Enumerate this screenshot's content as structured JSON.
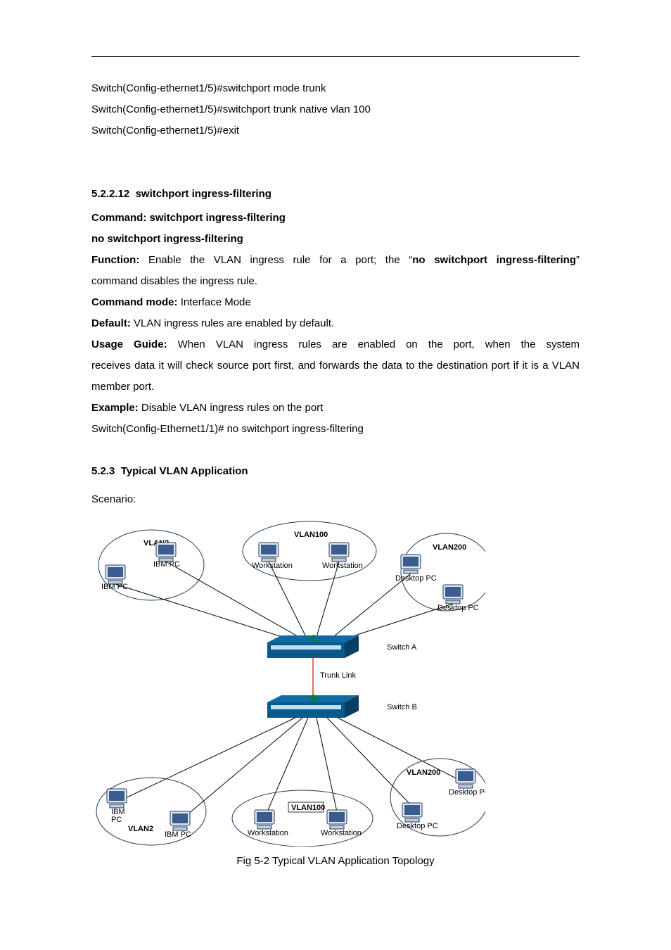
{
  "code": {
    "l1": "Switch(Config-ethernet1/5)#switchport mode trunk",
    "l2": "Switch(Config-ethernet1/5)#switchport trunk native vlan 100",
    "l3": "Switch(Config-ethernet1/5)#exit"
  },
  "cmd": {
    "heading_num": "5.2.2.12",
    "heading_txt": "switchport ingress-filtering",
    "command_lbl": "Command:",
    "command_txt": "switchport ingress-filtering",
    "no_form": "no switchport ingress-filtering",
    "function_lbl": "Function:",
    "function_txt_a": "Enable the VLAN ingress rule for a port; the “",
    "function_txt_b": "no switchport ingress-filtering",
    "function_txt_c": "”",
    "function_txt2": "command disables the ingress rule.",
    "mode_lbl": "Command mode:",
    "mode_txt": "Interface Mode",
    "default_lbl": "Default:",
    "default_txt": "VLAN ingress rules are enabled by default.",
    "usage_lbl": "Usage Guide:",
    "usage_txt1": "When VLAN ingress rules are enabled on the port, when the system",
    "usage_txt2": "receives data it will check source port first, and forwards the data to the destination port if it is a VLAN member port.",
    "example_lbl": "Example:",
    "example_txt": "Disable VLAN ingress rules on the port",
    "example_cmd": "Switch(Config-Ethernet1/1)# no switchport ingress-filtering"
  },
  "typ": {
    "heading_num": "5.2.3",
    "heading_txt": "Typical VLAN Application",
    "scenario": "Scenario:"
  },
  "diagram": {
    "vlan2": "VLAN2",
    "vlan100": "VLAN100",
    "vlan200": "VLAN200",
    "ibmpc": "IBM PC",
    "ibm": "IBM",
    "pc": "PC",
    "workstation": "Workstation",
    "desktop": "Desktop PC",
    "switchA": "Switch A",
    "switchB": "Switch B",
    "trunk": "Trunk Link"
  },
  "caption": "Fig 5-2 Typical VLAN Application Topology"
}
